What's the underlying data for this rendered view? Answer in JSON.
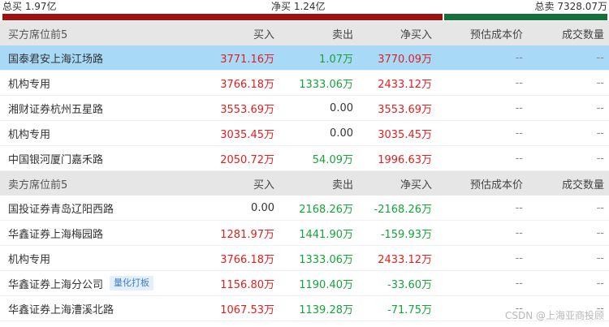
{
  "summary": {
    "total_buy": "总买 1.97亿",
    "net_buy": "净买 1.24亿",
    "total_sell": "总卖 7328.07万"
  },
  "colors": {
    "buy_bar": "#a30f0f",
    "sell_bar": "#15713b",
    "highlight_row": "#a8d9f7",
    "up": "#e02020",
    "down": "#16a33a"
  },
  "buy_section": {
    "headers": [
      "买方席位前5",
      "买入",
      "卖出",
      "净买入",
      "预估成本价",
      "成交数量"
    ],
    "rows": [
      {
        "name": "国泰君安上海江场路",
        "buy": "3771.16万",
        "sell": "1.07万",
        "net": "3770.09万",
        "cost": "--",
        "volume": "--"
      },
      {
        "name": "机构专用",
        "buy": "3766.18万",
        "sell": "1333.06万",
        "net": "2433.12万",
        "cost": "--",
        "volume": "--"
      },
      {
        "name": "湘财证券杭州五星路",
        "buy": "3553.69万",
        "sell": "0.00",
        "net": "3553.69万",
        "cost": "--",
        "volume": "--"
      },
      {
        "name": "机构专用",
        "buy": "3035.45万",
        "sell": "0.00",
        "net": "3035.45万",
        "cost": "--",
        "volume": "--"
      },
      {
        "name": "中国银河厦门嘉禾路",
        "buy": "2050.72万",
        "sell": "54.09万",
        "net": "1996.63万",
        "cost": "--",
        "volume": "--"
      }
    ]
  },
  "sell_section": {
    "headers": [
      "卖方席位前5",
      "买入",
      "卖出",
      "净买入",
      "预估成本价",
      "成交数量"
    ],
    "rows": [
      {
        "name": "国投证券青岛辽阳西路",
        "buy": "0.00",
        "sell": "2168.26万",
        "net": "-2168.26万",
        "cost": "--",
        "volume": "--"
      },
      {
        "name": "华鑫证券上海梅园路",
        "buy": "1281.97万",
        "sell": "1441.90万",
        "net": "-159.93万",
        "cost": "--",
        "volume": "--"
      },
      {
        "name": "机构专用",
        "buy": "3766.18万",
        "sell": "1333.06万",
        "net": "2433.12万",
        "cost": "--",
        "volume": "--"
      },
      {
        "name": "华鑫证券上海分公司",
        "tag": "量化打板",
        "buy": "1156.80万",
        "sell": "1190.40万",
        "net": "-33.60万",
        "cost": "--",
        "volume": "--"
      },
      {
        "name": "华鑫证券上海漕溪北路",
        "buy": "1067.53万",
        "sell": "1139.28万",
        "net": "-71.75万",
        "cost": "--",
        "volume": "--"
      }
    ]
  },
  "watermark": "CSDN @上海亚商投顾"
}
